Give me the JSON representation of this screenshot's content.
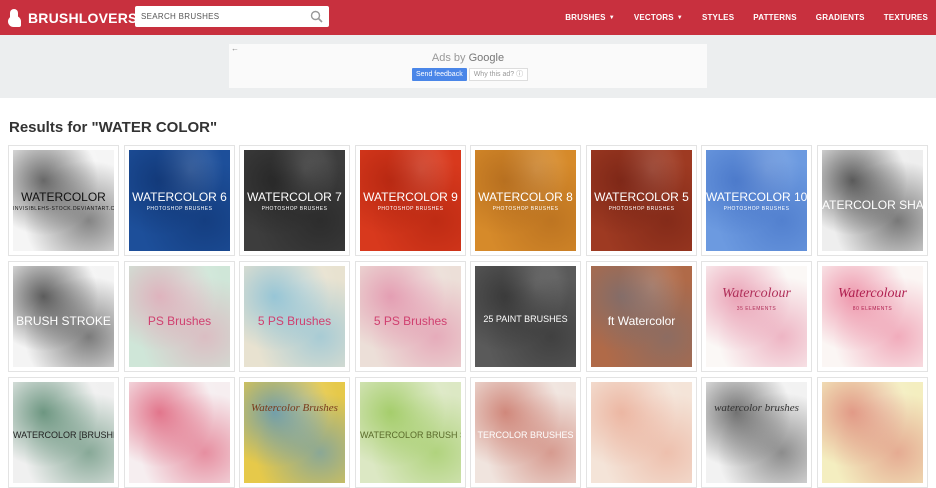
{
  "header": {
    "logo_text": "BRUSHLOVERS",
    "search_placeholder": "SEARCH BRUSHES",
    "nav": [
      {
        "label": "BRUSHES",
        "dropdown": true
      },
      {
        "label": "VECTORS",
        "dropdown": true
      },
      {
        "label": "STYLES",
        "dropdown": false
      },
      {
        "label": "PATTERNS",
        "dropdown": false
      },
      {
        "label": "GRADIENTS",
        "dropdown": false
      },
      {
        "label": "TEXTURES",
        "dropdown": false
      }
    ]
  },
  "ad": {
    "back_arrow": "←",
    "ads_by": "Ads by",
    "google": "Google",
    "send_feedback": "Send feedback",
    "why_this_ad": "Why this ad? ⓘ"
  },
  "results": {
    "title": "Results for \"WATER COLOR\""
  },
  "thumbnails": [
    {
      "caption": "WATERCOLOR",
      "sub": "INVISIBLEHS-STOCK.DEVIANTART.COM",
      "bg": "#f5f5f5",
      "accent": "#222222",
      "text_color": "#111111"
    },
    {
      "caption": "WATERCOLOR 6",
      "sub": "PHOTOSHOP BRUSHES",
      "bg": "#1d4f9a",
      "accent": "#0d2f6a",
      "text_color": "#ffffff"
    },
    {
      "caption": "WATERCOLOR 7",
      "sub": "PHOTOSHOP BRUSHES",
      "bg": "#3d3d3d",
      "accent": "#1e1e1e",
      "text_color": "#ffffff"
    },
    {
      "caption": "WATERCOLOR 9",
      "sub": "PHOTOSHOP BRUSHES",
      "bg": "#d8391d",
      "accent": "#a8200c",
      "text_color": "#ffffff"
    },
    {
      "caption": "WATERCOLOR 8",
      "sub": "PHOTOSHOP BRUSHES",
      "bg": "#d68a2a",
      "accent": "#a8621a",
      "text_color": "#ffffff"
    },
    {
      "caption": "WATERCOLOR 5",
      "sub": "PHOTOSHOP BRUSHES",
      "bg": "#9e3a22",
      "accent": "#6e1e12",
      "text_color": "#ffffff"
    },
    {
      "caption": "WATERCOLOR 10",
      "sub": "PHOTOSHOP BRUSHES",
      "bg": "#6c9ae0",
      "accent": "#3c6ac0",
      "text_color": "#ffffff"
    },
    {
      "caption": "ATERCOLOR SHA",
      "sub": "",
      "bg": "#eeeeee",
      "accent": "#111111",
      "text_color": "#ffffff"
    },
    {
      "caption": "BRUSH STROKE",
      "sub": "",
      "bg": "#f4f4f4",
      "accent": "#111111",
      "text_color": "#ffffff"
    },
    {
      "caption": "PS Brushes",
      "sub": "",
      "bg": "#cfe6d8",
      "accent": "#e59ab0",
      "text_color": "#d04070"
    },
    {
      "caption": "5 PS Brushes",
      "sub": "",
      "bg": "#e8e2d0",
      "accent": "#6fb7d8",
      "text_color": "#d04070"
    },
    {
      "caption": "5 PS Brushes",
      "sub": "",
      "bg": "#ecdfd8",
      "accent": "#e07ea0",
      "text_color": "#d04070"
    },
    {
      "caption": "25 PAINT BRUSHES",
      "sub": "",
      "bg": "#5a5a5a",
      "accent": "#2a2a2a",
      "text_color": "#ffffff"
    },
    {
      "caption": "ft Watercolor",
      "sub": "",
      "bg": "#b06a48",
      "accent": "#6e6e78",
      "text_color": "#ffffff"
    },
    {
      "caption": "Watercolour",
      "sub": "35 ELEMENTS",
      "bg": "#fbf8f6",
      "accent": "#e27a98",
      "text_color": "#b0305a"
    },
    {
      "caption": "Watercolour",
      "sub": "80 ELEMENTS",
      "bg": "#fbf6f4",
      "accent": "#e86a8a",
      "text_color": "#b02050"
    },
    {
      "caption": "WATERCOLOR [BRUSHES]",
      "sub": "",
      "bg": "#f0f0f0",
      "accent": "#2c6a4a",
      "text_color": "#222222"
    },
    {
      "caption": "",
      "sub": "",
      "bg": "#f6eef0",
      "accent": "#d83a5a",
      "text_color": "#ffffff"
    },
    {
      "caption": "Watercolor Brushes",
      "sub": "",
      "bg": "#e6c94a",
      "accent": "#3a8ad8",
      "text_color": "#7a3a1a"
    },
    {
      "caption": "WATERCOLOR BRUSH SE",
      "sub": "",
      "bg": "#dce8c4",
      "accent": "#8ac040",
      "text_color": "#5a6a2a"
    },
    {
      "caption": "TERCOLOR BRUSHES",
      "sub": "",
      "bg": "#f0e4de",
      "accent": "#c05a4a",
      "text_color": "#ffffff"
    },
    {
      "caption": "",
      "sub": "",
      "bg": "#f4e4d8",
      "accent": "#e8a088",
      "text_color": "#ffffff"
    },
    {
      "caption": "watercolor brushes",
      "sub": "",
      "bg": "#f2f2f2",
      "accent": "#333333",
      "text_color": "#333333"
    },
    {
      "caption": "",
      "sub": "",
      "bg": "#f4eec0",
      "accent": "#d8706a",
      "text_color": "#ffffff"
    }
  ]
}
